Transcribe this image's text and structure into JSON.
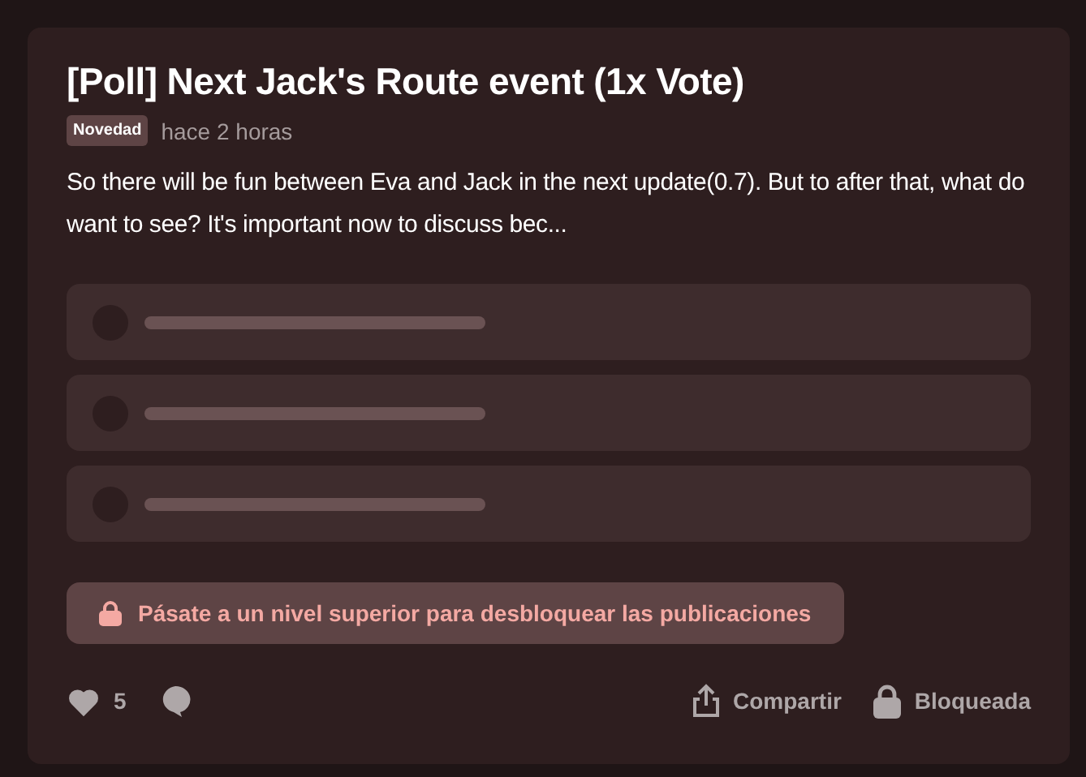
{
  "post": {
    "title": "[Poll] Next Jack's Route event (1x Vote)",
    "tag": "Novedad",
    "time": "hace 2 horas",
    "body": "So there will be fun between Eva and Jack in the next update(0.7). But to after that, what do want to see? It's important now to discuss bec...",
    "poll_options": [
      {
        "selected": false
      },
      {
        "selected": false
      },
      {
        "selected": false
      }
    ],
    "unlock_banner": "Pásate a un nivel superior para desbloquear las publicaciones",
    "likes": "5",
    "share": "Compartir",
    "locked": "Bloqueada"
  }
}
